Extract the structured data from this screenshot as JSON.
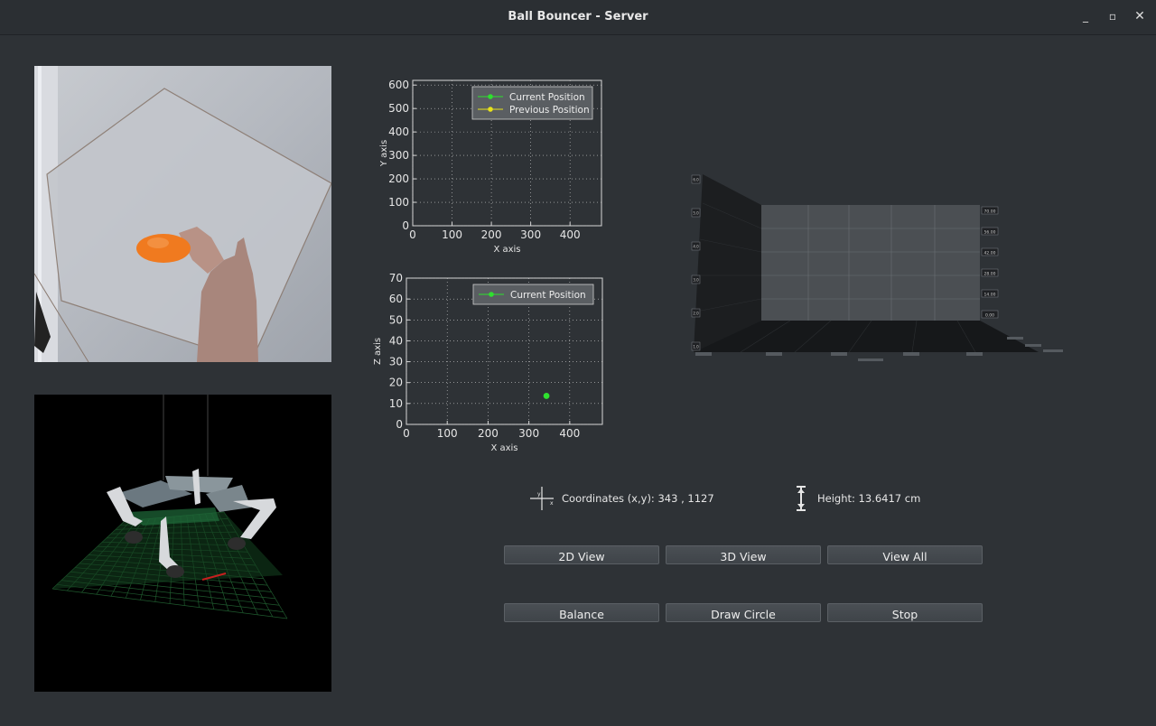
{
  "window": {
    "title": "Ball Bouncer - Server",
    "controls": {
      "minimize": "_",
      "maximize": "▫",
      "close": "✕"
    }
  },
  "readouts": {
    "coordinates": "Coordinates (x,y): 343  , 1127",
    "height": "Height: 13.6417 cm"
  },
  "buttons": {
    "view_2d": "2D View",
    "view_3d": "3D View",
    "view_all": "View All",
    "balance": "Balance",
    "draw_circle": "Draw Circle",
    "stop": "Stop"
  },
  "colors": {
    "background": "#2e3236",
    "current_position": "#2fe02f",
    "previous_position": "#e8e21a",
    "ball": "#f07a1f",
    "sim_grid": "#1f5a2e"
  },
  "chart_data": [
    {
      "type": "scatter",
      "xlabel": "X axis",
      "ylabel": "Y axis",
      "xlim": [
        0,
        480
      ],
      "ylim": [
        0,
        620
      ],
      "xticks": [
        0,
        100,
        200,
        300,
        400
      ],
      "yticks": [
        0,
        100,
        200,
        300,
        400,
        500,
        600
      ],
      "grid": true,
      "legend_position": "top-right",
      "series": [
        {
          "name": "Current Position",
          "color": "#2fe02f",
          "points": []
        },
        {
          "name": "Previous Position",
          "color": "#e8e21a",
          "points": []
        }
      ]
    },
    {
      "type": "scatter",
      "xlabel": "X axis",
      "ylabel": "Z axis",
      "xlim": [
        0,
        480
      ],
      "ylim": [
        0,
        70
      ],
      "xticks": [
        0,
        100,
        200,
        300,
        400
      ],
      "yticks": [
        0,
        10,
        20,
        30,
        40,
        50,
        60,
        70
      ],
      "grid": true,
      "legend_position": "top-right",
      "series": [
        {
          "name": "Current Position",
          "color": "#2fe02f",
          "points": [
            [
              343,
              13.64
            ]
          ]
        }
      ]
    }
  ],
  "plot3d": {
    "right_tick_labels": [
      "70.00",
      "56.00",
      "42.00",
      "28.00",
      "14.00",
      "0.00"
    ],
    "left_tick_labels": [
      "6.0",
      "5.0",
      "4.0",
      "3.0",
      "2.0",
      "1.0"
    ]
  }
}
